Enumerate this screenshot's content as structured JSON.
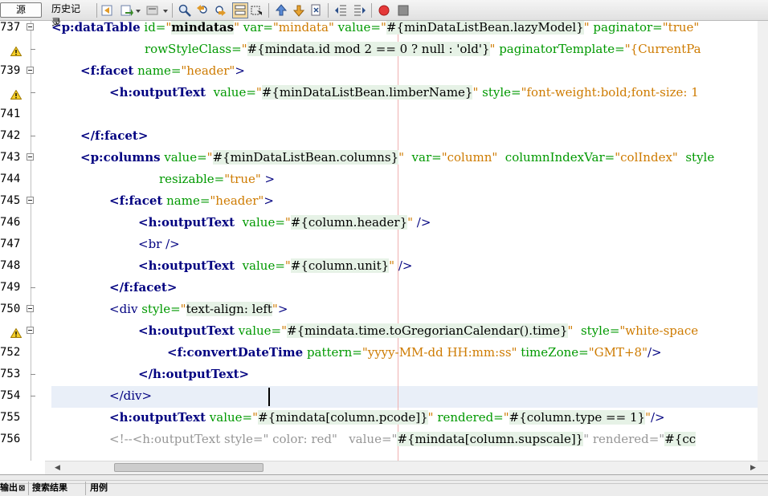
{
  "toolbar": {
    "tabs": [
      "源",
      "历史记录"
    ],
    "icons": [
      "back-to-last-edit-icon",
      "history-nav-icon",
      "dropdown-icon",
      "source-action-icon",
      "dropdown-icon",
      "find-icon",
      "find-previous-icon",
      "find-next-icon",
      "toggle-highlight-icon",
      "find-selection-icon",
      "previous-bookmark-icon",
      "next-bookmark-icon",
      "toggle-bookmark-icon",
      "shift-left-icon",
      "shift-right-icon",
      "start-macro-icon",
      "stop-macro-icon"
    ]
  },
  "editor": {
    "lines": [
      {
        "num": "737",
        "warn": false,
        "fold": true
      },
      {
        "num": "",
        "warn": true,
        "fold": false
      },
      {
        "num": "739",
        "warn": false,
        "fold": true
      },
      {
        "num": "",
        "warn": true,
        "fold": false
      },
      {
        "num": "741",
        "warn": false,
        "fold": false
      },
      {
        "num": "742",
        "warn": false,
        "fold": false
      },
      {
        "num": "743",
        "warn": false,
        "fold": true
      },
      {
        "num": "744",
        "warn": false,
        "fold": false
      },
      {
        "num": "745",
        "warn": false,
        "fold": true
      },
      {
        "num": "746",
        "warn": false,
        "fold": false
      },
      {
        "num": "747",
        "warn": false,
        "fold": false
      },
      {
        "num": "748",
        "warn": false,
        "fold": false
      },
      {
        "num": "749",
        "warn": false,
        "fold": false
      },
      {
        "num": "750",
        "warn": false,
        "fold": true
      },
      {
        "num": "",
        "warn": true,
        "fold": false
      },
      {
        "num": "752",
        "warn": false,
        "fold": false
      },
      {
        "num": "753",
        "warn": false,
        "fold": false
      },
      {
        "num": "754",
        "warn": false,
        "fold": false
      },
      {
        "num": "755",
        "warn": false,
        "fold": false
      },
      {
        "num": "756",
        "warn": false,
        "fold": false
      }
    ],
    "tokens": {
      "l0": [
        "<p:dataTable",
        " id=",
        "\"",
        "mindatas",
        "\"",
        " var=",
        "\"mindata\"",
        " value=",
        "\"",
        "#{minDataListBean.lazyModel}",
        "\"",
        " paginator=",
        "\"true\""
      ],
      "l1": [
        "rowStyleClass=",
        "\"",
        "#{mindata.id mod 2 == 0 ? null : 'old'}",
        "\"",
        " paginatorTemplate=",
        "\"{CurrentPa"
      ],
      "l2": [
        "<f:facet",
        " name=",
        "\"header\"",
        ">"
      ],
      "l3": [
        "<h:outputText",
        "  value=",
        "\"",
        "#{minDataListBean.limberName}",
        "\"",
        " style=",
        "\"font-weight:bold;font-size: 1"
      ],
      "l5": [
        "</f:facet>"
      ],
      "l6": [
        "<p:columns",
        " value=",
        "\"",
        "#{minDataListBean.columns}",
        "\"",
        "  var=",
        "\"column\"",
        "  columnIndexVar=",
        "\"colIndex\"",
        "  style"
      ],
      "l7": [
        "resizable=",
        "\"true\"",
        " >"
      ],
      "l8": [
        "<f:facet",
        " name=",
        "\"header\"",
        ">"
      ],
      "l9": [
        "<h:outputText",
        "  value=",
        "\"",
        "#{column.header}",
        "\"",
        " />"
      ],
      "l10": [
        "<br />"
      ],
      "l11": [
        "<h:outputText",
        "  value=",
        "\"",
        "#{column.unit}",
        "\"",
        " />"
      ],
      "l12": [
        "</f:facet>"
      ],
      "l13": [
        "<div",
        " style=",
        "\"",
        "text-align: left",
        "\"",
        ">"
      ],
      "l14": [
        "<h:outputText",
        " value=",
        "\"",
        "#{mindata.time.toGregorianCalendar().time}",
        "\"",
        "  style=",
        "\"white-space"
      ],
      "l15": [
        "<f:convertDateTime",
        " pattern=",
        "\"yyyy-MM-dd HH:mm:ss\"",
        " timeZone=",
        "\"GMT+8\"",
        "/>"
      ],
      "l16": [
        "</h:outputText>"
      ],
      "l17": [
        "</div>"
      ],
      "l18": [
        "<h:outputText",
        " value=",
        "\"",
        "#{mindata[column.pcode]}",
        "\"",
        " rendered=",
        "\"",
        "#{column.type == 1}",
        "\"",
        "/>"
      ],
      "l19": [
        "<!--<h:outputText style=\" color: red\"   value=\"",
        "#{mindata[column.supscale]}",
        "\" rendered=\"",
        "#{cc"
      ]
    }
  },
  "bottom": {
    "tabs": [
      "输出",
      "搜索结果",
      "用例"
    ],
    "close_glyph": "⊠"
  },
  "colors": {
    "tag": "#000080",
    "attribute": "#009900",
    "string": "#ce7b00",
    "el_background": "#e6f2e6",
    "comment": "#969696",
    "caret_line": "#e9eff8",
    "right_margin": "#f0b0b0"
  }
}
